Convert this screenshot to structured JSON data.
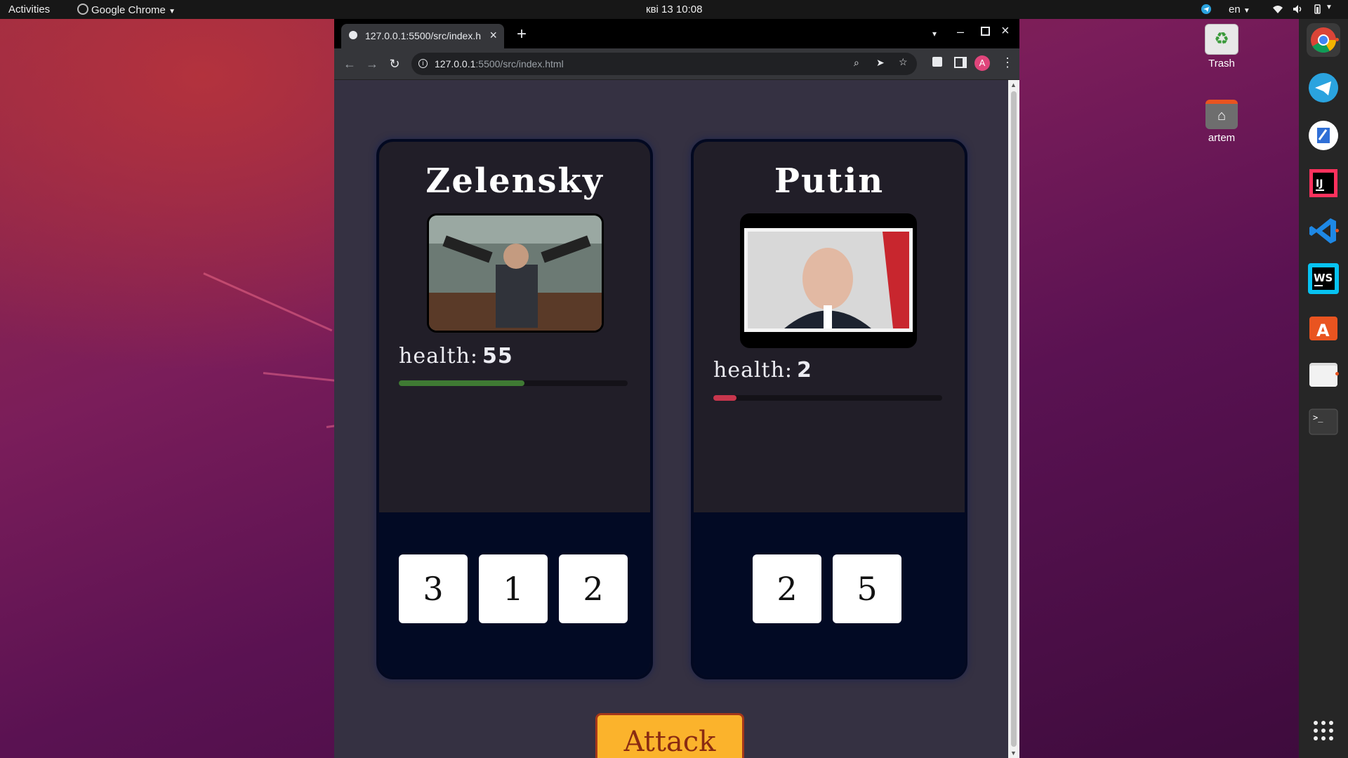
{
  "topbar": {
    "activities": "Activities",
    "app_name": "Google Chrome",
    "datetime": "кві 13  10:08",
    "lang": "en"
  },
  "desktop": {
    "icons": [
      {
        "label": "Trash",
        "icon": "trash-icon"
      },
      {
        "label": "artem",
        "icon": "home-folder-icon"
      }
    ]
  },
  "dock": {
    "apps": [
      "chrome",
      "telegram",
      "xournal",
      "intellij-idea",
      "vscode",
      "webstorm",
      "app-center",
      "files",
      "terminal"
    ],
    "show_apps": "show-applications-icon"
  },
  "browser": {
    "tab_title": "127.0.0.1:5500/src/index.h",
    "url_host": "127.0.0.1",
    "url_rest": ":5500/src/index.html",
    "profile_initial": "A"
  },
  "game": {
    "players": [
      {
        "name": "Zelensky",
        "health_label": "health:",
        "health": "55",
        "health_fraction": 0.55,
        "bar_color": "#3f7a33",
        "dice": [
          "3",
          "1",
          "2"
        ]
      },
      {
        "name": "Putin",
        "health_label": "health:",
        "health": "2",
        "health_fraction": 0.1,
        "bar_color": "#c8364d",
        "dice": [
          "2",
          "5"
        ]
      }
    ],
    "attack_label": "Attack"
  }
}
